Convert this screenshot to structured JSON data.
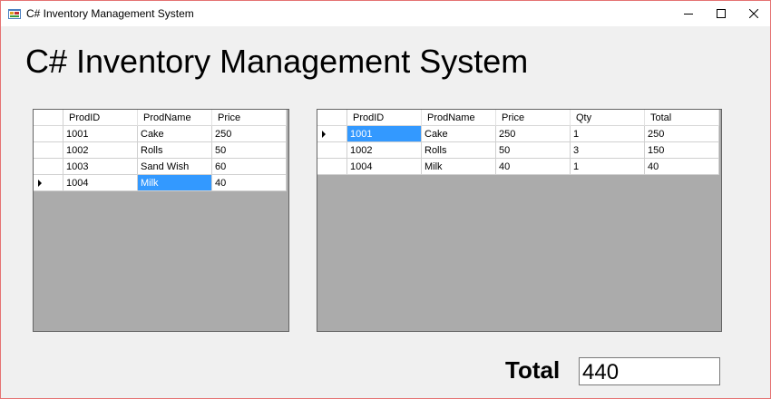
{
  "window": {
    "title": "C# Inventory Management System",
    "controls": {
      "minimize": "—",
      "maximize": "☐",
      "close": "✕"
    },
    "icon": "winforms-app-icon"
  },
  "heading": "C# Inventory Management System",
  "products_grid": {
    "columns": [
      "ProdID",
      "ProdName",
      "Price"
    ],
    "rows": [
      [
        "1001",
        "Cake",
        "250"
      ],
      [
        "1002",
        "Rolls",
        "50"
      ],
      [
        "1003",
        "Sand Wish",
        "60"
      ],
      [
        "1004",
        "Milk",
        "40"
      ]
    ],
    "current_row": 3,
    "selected_column": 1
  },
  "cart_grid": {
    "columns": [
      "ProdID",
      "ProdName",
      "Price",
      "Qty",
      "Total"
    ],
    "rows": [
      [
        "1001",
        "Cake",
        "250",
        "1",
        "250"
      ],
      [
        "1002",
        "Rolls",
        "50",
        "3",
        "150"
      ],
      [
        "1004",
        "Milk",
        "40",
        "1",
        "40"
      ]
    ],
    "current_row": 0,
    "selected_column": 0
  },
  "total": {
    "label": "Total",
    "value": "440"
  },
  "colors": {
    "selection": "#3399ff",
    "grid_background": "#ababab",
    "form_background": "#f0f0f0"
  }
}
